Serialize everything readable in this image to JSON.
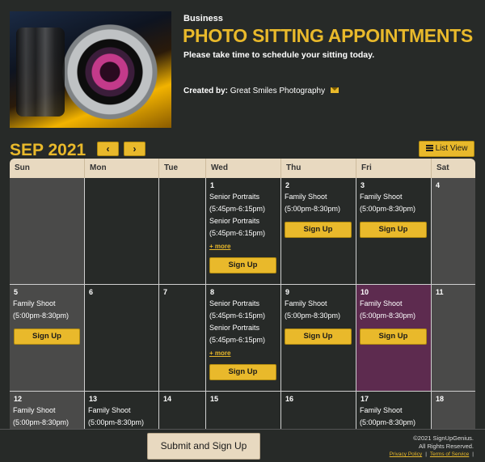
{
  "header": {
    "category": "Business",
    "title": "PHOTO SITTING APPOINTMENTS",
    "subtitle": "Please take time to schedule your sitting today.",
    "created_by_label": "Created by:",
    "created_by_name": "Great Smiles Photography",
    "image_icon": "camera-lens-photo"
  },
  "calendar": {
    "month_label": "SEP 2021",
    "prev_icon": "‹",
    "next_icon": "›",
    "list_view_label": "List View",
    "days_of_week": [
      "Sun",
      "Mon",
      "Tue",
      "Wed",
      "Thu",
      "Fri",
      "Sat"
    ],
    "more_label": "+ more",
    "signup_label": "Sign Up",
    "cells": {
      "d1": {
        "num": "1",
        "slots": [
          "Senior Portraits",
          "(5:45pm-6:15pm)",
          "Senior Portraits",
          "(5:45pm-6:15pm)"
        ]
      },
      "d2": {
        "num": "2",
        "slots": [
          "Family Shoot",
          "(5:00pm-8:30pm)"
        ]
      },
      "d3": {
        "num": "3",
        "slots": [
          "Family Shoot",
          "(5:00pm-8:30pm)"
        ]
      },
      "d4": {
        "num": "4"
      },
      "d5": {
        "num": "5",
        "slots": [
          "Family Shoot",
          "(5:00pm-8:30pm)"
        ]
      },
      "d6": {
        "num": "6"
      },
      "d7": {
        "num": "7"
      },
      "d8": {
        "num": "8",
        "slots": [
          "Senior Portraits",
          "(5:45pm-6:15pm)",
          "Senior Portraits",
          "(5:45pm-6:15pm)"
        ]
      },
      "d9": {
        "num": "9",
        "slots": [
          "Family Shoot",
          "(5:00pm-8:30pm)"
        ]
      },
      "d10": {
        "num": "10",
        "slots": [
          "Family Shoot",
          "(5:00pm-8:30pm)"
        ]
      },
      "d11": {
        "num": "11"
      },
      "d12": {
        "num": "12",
        "slots": [
          "Family Shoot",
          "(5:00pm-8:30pm)"
        ]
      },
      "d13": {
        "num": "13",
        "slots": [
          "Family Shoot",
          "(5:00pm-8:30pm)"
        ]
      },
      "d14": {
        "num": "14"
      },
      "d15": {
        "num": "15"
      },
      "d16": {
        "num": "16"
      },
      "d17": {
        "num": "17",
        "slots": [
          "Family Shoot",
          "(5:00pm-8:30pm)"
        ]
      },
      "d18": {
        "num": "18"
      }
    }
  },
  "footer": {
    "submit_label": "Submit and Sign Up",
    "copyright_line1": "©2021 SignUpGenius.",
    "copyright_line2": "All Rights Reserved.",
    "privacy_label": "Privacy Policy",
    "separator": "|",
    "terms_label": "Terms of Service"
  },
  "colors": {
    "accent": "#e9b92b",
    "background": "#272a28",
    "header_bar": "#e8d9c0",
    "highlight_cell": "#5d2b4f",
    "inactive_cell": "#4a4a49"
  }
}
